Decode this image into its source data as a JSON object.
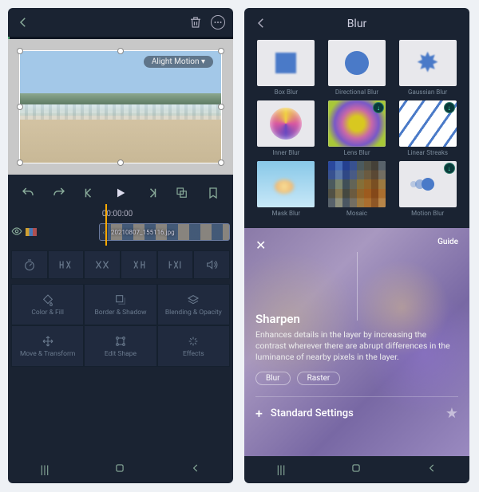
{
  "left": {
    "watermark": "Alight Motion ▾",
    "timecode": "00:00:00",
    "clip_filename": "20210807_155116.jpg",
    "toolCellsTop": [
      {
        "name": "speed-icon"
      },
      {
        "name": "split-left-icon"
      },
      {
        "name": "split-icon"
      },
      {
        "name": "split-right-icon"
      },
      {
        "name": "trim-icon"
      },
      {
        "name": "volume-icon"
      }
    ],
    "toolCells": [
      {
        "name": "color-fill",
        "label": "Color & Fill"
      },
      {
        "name": "border-shadow",
        "label": "Border & Shadow"
      },
      {
        "name": "blending-opacity",
        "label": "Blending & Opacity"
      },
      {
        "name": "move-transform",
        "label": "Move & Transform"
      },
      {
        "name": "edit-shape",
        "label": "Edit Shape"
      },
      {
        "name": "effects",
        "label": "Effects"
      }
    ]
  },
  "right": {
    "title": "Blur",
    "effects": [
      {
        "name": "box-blur",
        "label": "Box Blur",
        "thumb": "box",
        "dl": false
      },
      {
        "name": "directional-blur",
        "label": "Directional Blur",
        "thumb": "circle",
        "dl": false
      },
      {
        "name": "gaussian-blur",
        "label": "Gaussian Blur",
        "thumb": "star",
        "dl": false
      },
      {
        "name": "inner-blur",
        "label": "Inner Blur",
        "thumb": "inner",
        "dl": false
      },
      {
        "name": "lens-blur",
        "label": "Lens Blur",
        "thumb": "lens",
        "dl": true
      },
      {
        "name": "linear-streaks",
        "label": "Linear Streaks",
        "thumb": "streak",
        "dl": true
      },
      {
        "name": "mask-blur",
        "label": "Mask Blur",
        "thumb": "mask",
        "dl": false
      },
      {
        "name": "mosaic",
        "label": "Mosaic",
        "thumb": "mosaic",
        "dl": false
      },
      {
        "name": "motion-blur",
        "label": "Motion Blur",
        "thumb": "motion",
        "dl": true
      }
    ],
    "sheet": {
      "guide": "Guide",
      "title": "Sharpen",
      "desc": "Enhances details in the layer by increasing the contrast wherever there are abrupt differences in the luminance of nearby pixels in the layer.",
      "tags": [
        "Blur",
        "Raster"
      ],
      "standard": "Standard Settings"
    }
  }
}
